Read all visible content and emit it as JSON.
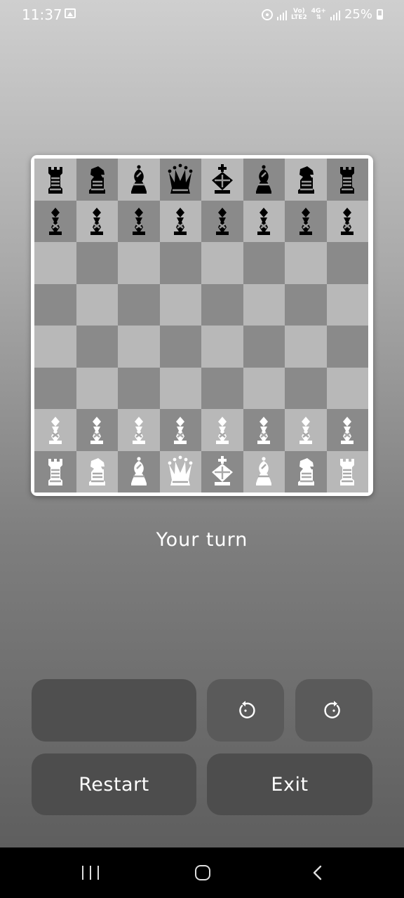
{
  "status_bar": {
    "time": "11:37",
    "network_badge_top": "Vo)",
    "network_badge_bottom": "LTE2",
    "network_type": "4G+",
    "battery": "25%",
    "icons": [
      "gallery-icon",
      "hotspot-icon",
      "signal-icon",
      "volte-icon",
      "data-icon",
      "signal-icon",
      "battery-icon"
    ]
  },
  "board": {
    "rows": [
      [
        {
          "c": "black",
          "p": "rook"
        },
        {
          "c": "black",
          "p": "knight"
        },
        {
          "c": "black",
          "p": "bishop"
        },
        {
          "c": "black",
          "p": "queen"
        },
        {
          "c": "black",
          "p": "king"
        },
        {
          "c": "black",
          "p": "bishop"
        },
        {
          "c": "black",
          "p": "knight"
        },
        {
          "c": "black",
          "p": "rook"
        }
      ],
      [
        {
          "c": "black",
          "p": "pawn"
        },
        {
          "c": "black",
          "p": "pawn"
        },
        {
          "c": "black",
          "p": "pawn"
        },
        {
          "c": "black",
          "p": "pawn"
        },
        {
          "c": "black",
          "p": "pawn"
        },
        {
          "c": "black",
          "p": "pawn"
        },
        {
          "c": "black",
          "p": "pawn"
        },
        {
          "c": "black",
          "p": "pawn"
        }
      ],
      [
        null,
        null,
        null,
        null,
        null,
        null,
        null,
        null
      ],
      [
        null,
        null,
        null,
        null,
        null,
        null,
        null,
        null
      ],
      [
        null,
        null,
        null,
        null,
        null,
        null,
        null,
        null
      ],
      [
        null,
        null,
        null,
        null,
        null,
        null,
        null,
        null
      ],
      [
        {
          "c": "white",
          "p": "pawn"
        },
        {
          "c": "white",
          "p": "pawn"
        },
        {
          "c": "white",
          "p": "pawn"
        },
        {
          "c": "white",
          "p": "pawn"
        },
        {
          "c": "white",
          "p": "pawn"
        },
        {
          "c": "white",
          "p": "pawn"
        },
        {
          "c": "white",
          "p": "pawn"
        },
        {
          "c": "white",
          "p": "pawn"
        }
      ],
      [
        {
          "c": "white",
          "p": "rook"
        },
        {
          "c": "white",
          "p": "knight"
        },
        {
          "c": "white",
          "p": "bishop"
        },
        {
          "c": "white",
          "p": "queen"
        },
        {
          "c": "white",
          "p": "king"
        },
        {
          "c": "white",
          "p": "bishop"
        },
        {
          "c": "white",
          "p": "knight"
        },
        {
          "c": "white",
          "p": "rook"
        }
      ]
    ],
    "light_color": "#b8b8b8",
    "dark_color": "#8a8a8a"
  },
  "game": {
    "turn_text": "Your turn"
  },
  "controls": {
    "undo_icon": "undo-icon",
    "redo_icon": "redo-icon",
    "restart_label": "Restart",
    "exit_label": "Exit"
  },
  "nav_bar": {
    "icons": [
      "recents-icon",
      "home-icon",
      "back-icon"
    ]
  }
}
